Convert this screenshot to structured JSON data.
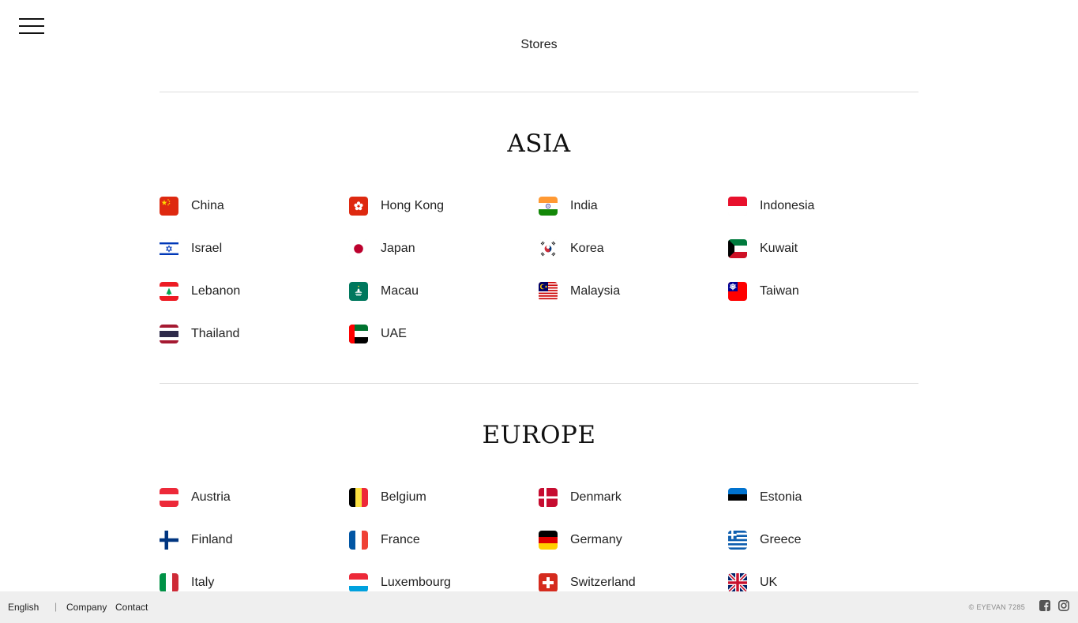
{
  "header": {
    "menu_icon": "hamburger-menu-icon",
    "title": "Stores"
  },
  "regions": [
    {
      "name": "ASIA",
      "countries": [
        {
          "name": "China",
          "flag": "china"
        },
        {
          "name": "Hong Kong",
          "flag": "hong-kong"
        },
        {
          "name": "India",
          "flag": "india"
        },
        {
          "name": "Indonesia",
          "flag": "indonesia"
        },
        {
          "name": "Israel",
          "flag": "israel"
        },
        {
          "name": "Japan",
          "flag": "japan"
        },
        {
          "name": "Korea",
          "flag": "korea"
        },
        {
          "name": "Kuwait",
          "flag": "kuwait"
        },
        {
          "name": "Lebanon",
          "flag": "lebanon"
        },
        {
          "name": "Macau",
          "flag": "macau"
        },
        {
          "name": "Malaysia",
          "flag": "malaysia"
        },
        {
          "name": "Taiwan",
          "flag": "taiwan"
        },
        {
          "name": "Thailand",
          "flag": "thailand"
        },
        {
          "name": "UAE",
          "flag": "uae"
        }
      ]
    },
    {
      "name": "EUROPE",
      "countries": [
        {
          "name": "Austria",
          "flag": "austria"
        },
        {
          "name": "Belgium",
          "flag": "belgium"
        },
        {
          "name": "Denmark",
          "flag": "denmark"
        },
        {
          "name": "Estonia",
          "flag": "estonia"
        },
        {
          "name": "Finland",
          "flag": "finland"
        },
        {
          "name": "France",
          "flag": "france"
        },
        {
          "name": "Germany",
          "flag": "germany"
        },
        {
          "name": "Greece",
          "flag": "greece"
        },
        {
          "name": "Italy",
          "flag": "italy"
        },
        {
          "name": "Luxembourg",
          "flag": "luxembourg"
        },
        {
          "name": "Switzerland",
          "flag": "switzerland"
        },
        {
          "name": "UK",
          "flag": "uk"
        }
      ]
    }
  ],
  "footer": {
    "language": "English",
    "separator": "|",
    "company": "Company",
    "contact": "Contact",
    "copyright": "© EYEVAN 7285",
    "social_icons": [
      "facebook-icon",
      "instagram-icon"
    ]
  },
  "colors": {
    "text": "#222222",
    "divider": "#dcdcdc",
    "footer_bg": "#efefef",
    "social_icon": "#555555"
  }
}
